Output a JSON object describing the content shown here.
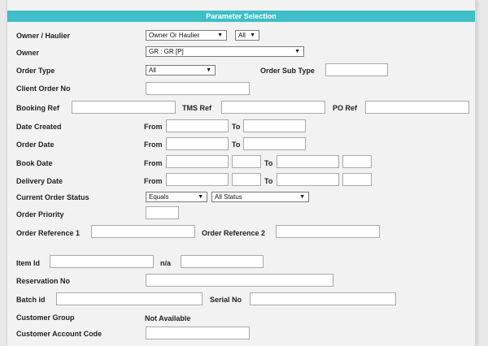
{
  "header": {
    "title": "Parameter Selection"
  },
  "owner_haulier": {
    "label": "Owner / Haulier",
    "select1": "Owner Or Haulier",
    "select2": "All"
  },
  "owner": {
    "label": "Owner",
    "select": "GR : GR [P]"
  },
  "order_type": {
    "label": "Order Type",
    "select": "All",
    "sub_label": "Order Sub Type",
    "sub_value": ""
  },
  "client_order_no": {
    "label": "Client Order No",
    "value": ""
  },
  "booking_ref": {
    "label": "Booking Ref",
    "value": "",
    "tms_label": "TMS Ref",
    "tms_value": "",
    "po_label": "PO Ref",
    "po_value": ""
  },
  "date_created": {
    "label": "Date Created",
    "from": "From",
    "to": "To"
  },
  "order_date": {
    "label": "Order Date",
    "from": "From",
    "to": "To"
  },
  "book_date": {
    "label": "Book Date",
    "from": "From",
    "to": "To"
  },
  "delivery_date": {
    "label": "Delivery Date",
    "from": "From",
    "to": "To"
  },
  "current_order_status": {
    "label": "Current Order Status",
    "operator": "Equals",
    "status": "All Status"
  },
  "order_priority": {
    "label": "Order Priority",
    "value": ""
  },
  "order_reference": {
    "label1": "Order Reference 1",
    "label2": "Order Reference 2"
  },
  "item_id": {
    "label": "Item Id",
    "na_label": "n/a"
  },
  "reservation_no": {
    "label": "Reservation No"
  },
  "batch_id": {
    "label": "Batch id",
    "serial_label": "Serial No"
  },
  "customer_group": {
    "label": "Customer Group",
    "value": "Not Available"
  },
  "customer_account_code": {
    "label": "Customer Account Code"
  },
  "icons": {
    "dropdown": "chevron-down-icon"
  }
}
